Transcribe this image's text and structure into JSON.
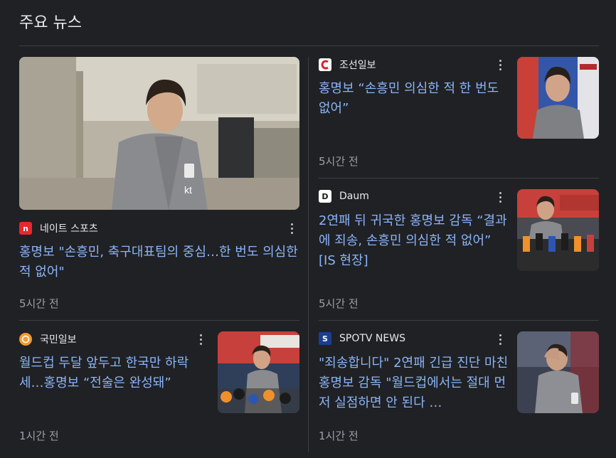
{
  "section_title": "주요 뉴스",
  "articles": [
    {
      "source": "네이트 스포츠",
      "title": "홍명보 \"손흥민, 축구대표팀의 중심…한 번도 의심한 적 없어\"",
      "time": "5시간 전",
      "logo_color": "#e8262d"
    },
    {
      "source": "조선일보",
      "title": "홍명보 “손흥민 의심한 적 한 번도 없어”",
      "time": "5시간 전",
      "logo_color": "#ffffff"
    },
    {
      "source": "Daum",
      "logo_letter": "D",
      "title": "2연패 뒤 귀국한 홍명보 감독 “결과에 죄송, 손흥민 의심한 적 없어” [IS 현장]",
      "time": "5시간 전",
      "logo_color": "#ffffff"
    },
    {
      "source": "국민일보",
      "title": "월드컵 두달 앞두고 한국만 하락세…홍명보 “전술은 완성돼”",
      "time": "1시간 전",
      "logo_color": "#f39a2e"
    },
    {
      "source": "SPOTV NEWS",
      "logo_letter": "S",
      "title": "\"죄송합니다\" 2연패 긴급 진단 마친 홍명보 감독 \"월드컵에서는 절대 먼저 실점하면 안 된다 …",
      "time": "1시간 전",
      "logo_color": "#1a3f8f"
    }
  ]
}
